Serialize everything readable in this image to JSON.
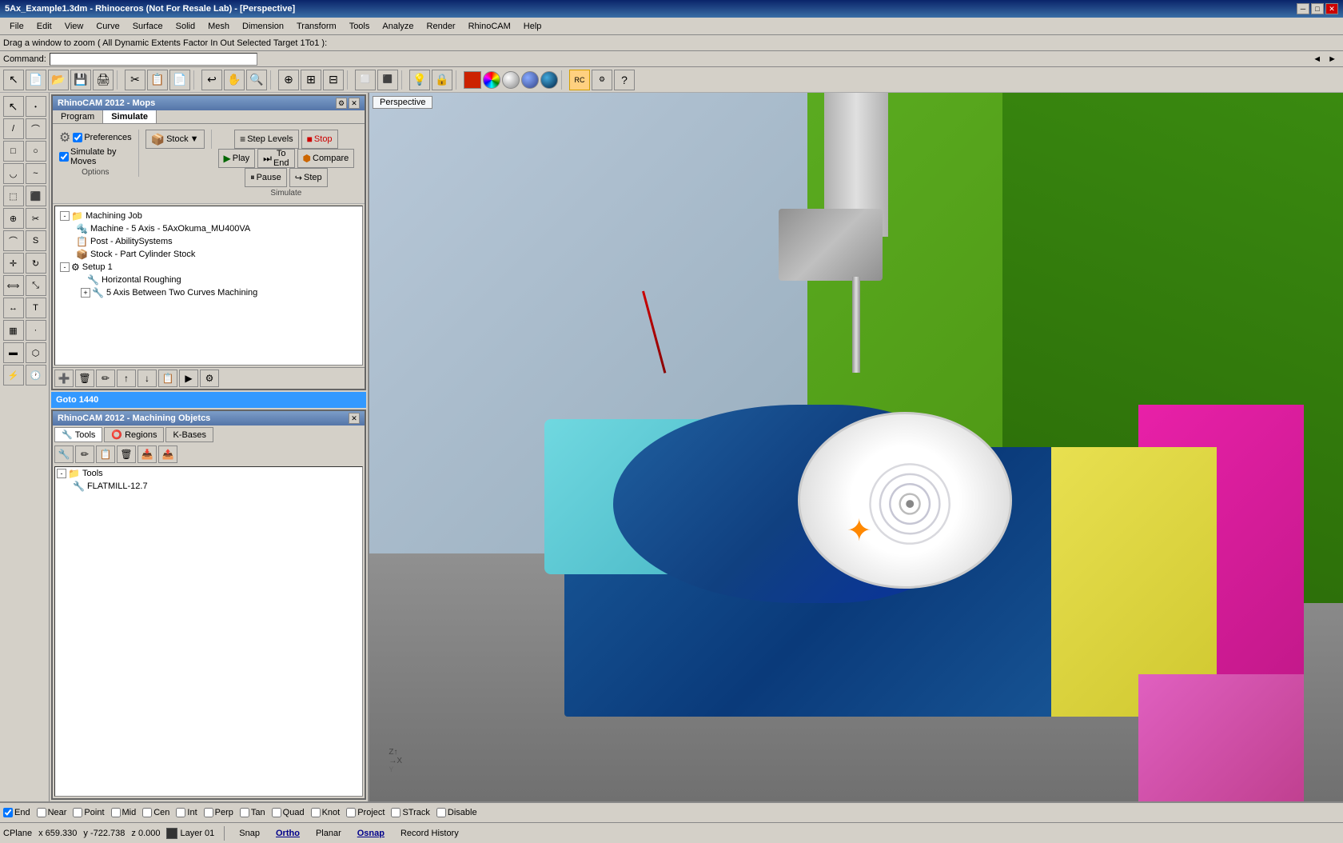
{
  "titlebar": {
    "title": "5Ax_Example1.3dm - Rhinoceros (Not For Resale Lab) - [Perspective]",
    "controls": [
      "minimize",
      "maximize",
      "close"
    ]
  },
  "menubar": {
    "items": [
      "File",
      "Edit",
      "View",
      "Curve",
      "Surface",
      "Solid",
      "Mesh",
      "Dimension",
      "Transform",
      "Tools",
      "Analyze",
      "Render",
      "RhinoCAM",
      "Help"
    ]
  },
  "commandbar": {
    "prompt": "Drag a window to zoom ( All Dynamic Extents Factor In Out Selected Target 1To1 ):",
    "command_label": "Command:"
  },
  "rhinocam_panel": {
    "title": "RhinoCAM 2012 - Mops",
    "tabs": [
      "Program",
      "Simulate"
    ],
    "active_tab": "Simulate",
    "options_label": "Options",
    "simulate_label": "Simulate"
  },
  "simulate_toolbar": {
    "preferences_label": "Preferences",
    "stock_label": "Stock",
    "stock_dropdown": true,
    "step_levels_label": "Step Levels",
    "stop_label": "Stop",
    "play_label": "Play",
    "to_end_label": "To End",
    "compare_label": "Compare",
    "pause_label": "Pause",
    "step_label": "Step"
  },
  "tree": {
    "items": [
      {
        "id": "machining-job",
        "label": "Machining Job",
        "level": 0,
        "expanded": true,
        "icon": "folder"
      },
      {
        "id": "machine",
        "label": "Machine - 5 Axis - 5AxOkuma_MU400VA",
        "level": 1,
        "icon": "machine"
      },
      {
        "id": "post",
        "label": "Post - AbilitySystems",
        "level": 1,
        "icon": "post"
      },
      {
        "id": "stock",
        "label": "Stock - Part Cylinder Stock",
        "level": 1,
        "icon": "stock"
      },
      {
        "id": "setup1",
        "label": "Setup 1",
        "level": 0,
        "expanded": true,
        "icon": "setup"
      },
      {
        "id": "horiz-rough",
        "label": "Horizontal Roughing",
        "level": 2,
        "icon": "operation"
      },
      {
        "id": "5ax-curves",
        "label": "5 Axis Between Two Curves Machining",
        "level": 2,
        "icon": "operation",
        "expanded": false
      }
    ]
  },
  "goto_bar": {
    "label": "Goto 1440"
  },
  "machining_objects": {
    "title": "RhinoCAM 2012 - Machining Objetcs",
    "tabs": [
      "Tools",
      "Regions",
      "K-Bases"
    ],
    "active_tab": "Tools",
    "tree": [
      {
        "id": "tools-root",
        "label": "Tools",
        "level": 0,
        "expanded": true,
        "icon": "folder"
      },
      {
        "id": "flatmill",
        "label": "FLATMILL-12.7",
        "level": 1,
        "icon": "tool"
      }
    ]
  },
  "viewport": {
    "label": "Perspective"
  },
  "statusbar": {
    "cplane": "CPlane",
    "x": "x 659.330",
    "y": "y -722.738",
    "z": "z 0.000",
    "layer_color": "#333333",
    "layer_name": "Layer 01",
    "snap": "Snap",
    "ortho": "Ortho",
    "planar": "Planar",
    "osnap": "Osnap",
    "record_history": "Record History",
    "checkboxes": [
      {
        "id": "end",
        "label": "End",
        "checked": true
      },
      {
        "id": "near",
        "label": "Near",
        "checked": false
      },
      {
        "id": "point",
        "label": "Point",
        "checked": false
      },
      {
        "id": "mid",
        "label": "Mid",
        "checked": false
      },
      {
        "id": "cen",
        "label": "Cen",
        "checked": false
      },
      {
        "id": "int",
        "label": "Int",
        "checked": false
      },
      {
        "id": "perp",
        "label": "Perp",
        "checked": false
      },
      {
        "id": "tan",
        "label": "Tan",
        "checked": false
      },
      {
        "id": "quad",
        "label": "Quad",
        "checked": false
      },
      {
        "id": "knot",
        "label": "Knot",
        "checked": false
      },
      {
        "id": "project",
        "label": "Project",
        "checked": false
      },
      {
        "id": "strack",
        "label": "STrack",
        "checked": false
      },
      {
        "id": "disable",
        "label": "Disable",
        "checked": false
      }
    ]
  },
  "icons": {
    "expand": "▶",
    "collapse": "▼",
    "folder": "📁",
    "tool": "🔧",
    "gear": "⚙",
    "play": "▶",
    "stop": "■",
    "pause": "⏸",
    "step_fwd": "⏭",
    "close": "✕",
    "minimize": "─",
    "maximize": "□"
  }
}
